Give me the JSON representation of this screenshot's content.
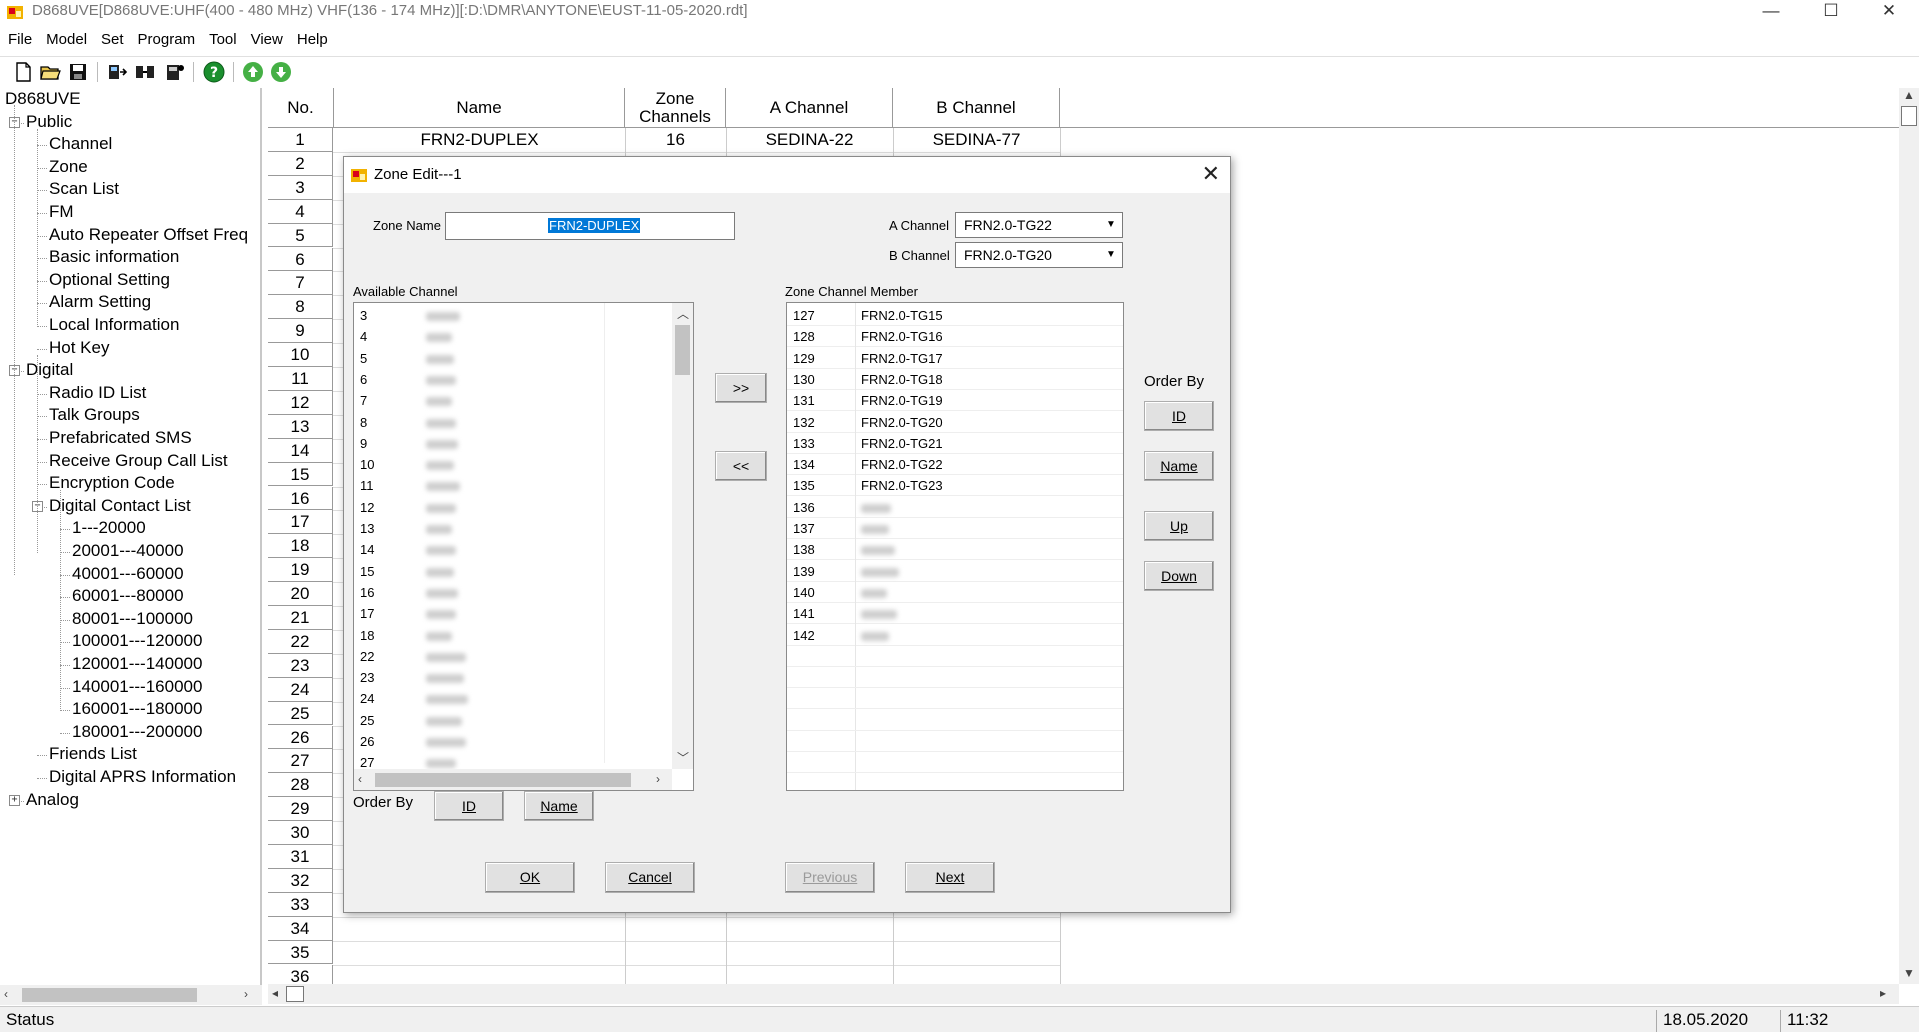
{
  "window": {
    "title": "D868UVE[D868UVE:UHF(400 - 480 MHz) VHF(136 - 174 MHz)][:D:\\DMR\\ANYTONE\\EUST-11-05-2020.rdt]",
    "minimize": "—",
    "maximize": "☐",
    "close": "✕"
  },
  "menu": [
    "File",
    "Model",
    "Set",
    "Program",
    "Tool",
    "View",
    "Help"
  ],
  "toolbar": {
    "icons": [
      "new-file-icon",
      "open-folder-icon",
      "save-icon",
      "read-radio-icon",
      "write-radio-icon",
      "radio-info-icon",
      "help-icon",
      "upload-icon",
      "download-icon"
    ]
  },
  "tree": {
    "root": "D868UVE",
    "public": "Public",
    "public_items": [
      "Channel",
      "Zone",
      "Scan List",
      "FM",
      "Auto Repeater Offset Freq",
      "Basic information",
      "Optional Setting",
      "Alarm Setting",
      "Local Information",
      "Hot Key"
    ],
    "digital": "Digital",
    "digital_items": [
      "Radio ID List",
      "Talk Groups",
      "Prefabricated SMS",
      "Receive Group Call List",
      "Encryption Code"
    ],
    "contact_list": "Digital Contact List",
    "contact_ranges": [
      "1---20000",
      "20001---40000",
      "40001---60000",
      "60001---80000",
      "80001---100000",
      "100001---120000",
      "120001---140000",
      "140001---160000",
      "160001---180000",
      "180001---200000"
    ],
    "digital_items_2": [
      "Friends List",
      "Digital APRS Information"
    ],
    "analog": "Analog"
  },
  "grid": {
    "headers": {
      "no": "No.",
      "name": "Name",
      "zone_channels": "Zone Channels",
      "a_channel": "A Channel",
      "b_channel": "B Channel"
    },
    "row1": {
      "no": "1",
      "name": "FRN2-DUPLEX",
      "zone_channels": "16",
      "a_channel": "SEDINA-22",
      "b_channel": "SEDINA-77"
    },
    "row_count": 36
  },
  "status": {
    "label": "Status",
    "date": "18.05.2020",
    "time": "11:32"
  },
  "dialog": {
    "title": "Zone Edit---1",
    "zone_name_label": "Zone Name",
    "zone_name_value": "FRN2-DUPLEX",
    "a_channel_label": "A Channel",
    "a_channel_value": "FRN2.0-TG22",
    "b_channel_label": "B Channel",
    "b_channel_value": "FRN2.0-TG20",
    "available_label": "Available Channel",
    "available_ids": [
      "3",
      "4",
      "5",
      "6",
      "7",
      "8",
      "9",
      "10",
      "11",
      "12",
      "13",
      "14",
      "15",
      "16",
      "17",
      "18",
      "22",
      "23",
      "24",
      "25",
      "26",
      "27"
    ],
    "member_label": "Zone Channel Member",
    "members": [
      {
        "id": "127",
        "name": "FRN2.0-TG15"
      },
      {
        "id": "128",
        "name": "FRN2.0-TG16"
      },
      {
        "id": "129",
        "name": "FRN2.0-TG17"
      },
      {
        "id": "130",
        "name": "FRN2.0-TG18"
      },
      {
        "id": "131",
        "name": "FRN2.0-TG19"
      },
      {
        "id": "132",
        "name": "FRN2.0-TG20"
      },
      {
        "id": "133",
        "name": "FRN2.0-TG21"
      },
      {
        "id": "134",
        "name": "FRN2.0-TG22"
      },
      {
        "id": "135",
        "name": "FRN2.0-TG23"
      },
      {
        "id": "136",
        "name": ""
      },
      {
        "id": "137",
        "name": ""
      },
      {
        "id": "138",
        "name": ""
      },
      {
        "id": "139",
        "name": ""
      },
      {
        "id": "140",
        "name": ""
      },
      {
        "id": "141",
        "name": ""
      },
      {
        "id": "142",
        "name": ""
      }
    ],
    "add_button": ">>",
    "remove_button": "<<",
    "order_by_label": "Order By",
    "order_id": "ID",
    "order_name": "Name",
    "up": "Up",
    "down": "Down",
    "ok": "OK",
    "cancel": "Cancel",
    "previous": "Previous",
    "next": "Next"
  }
}
